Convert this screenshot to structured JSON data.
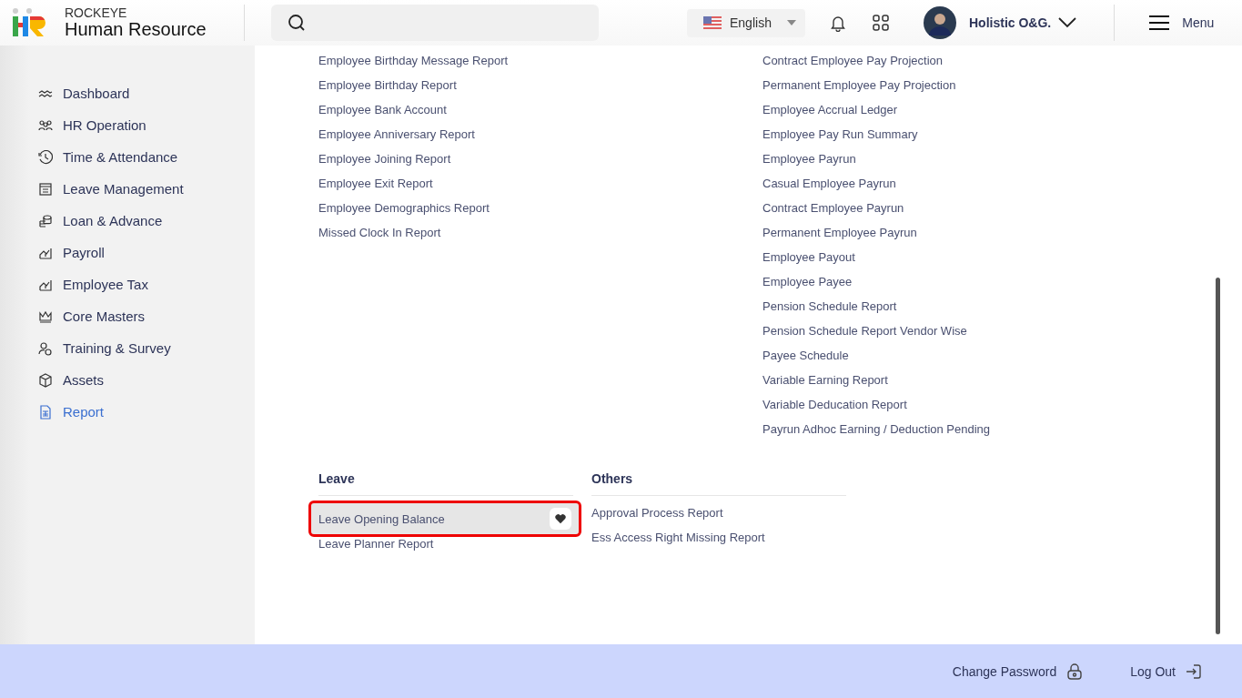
{
  "header": {
    "brand_top": "ROCKEYE",
    "brand": "Human Resource",
    "language": "English",
    "user": "Holistic O&G.",
    "menu": "Menu"
  },
  "sidebar": {
    "items": [
      {
        "label": "Dashboard",
        "selected": false
      },
      {
        "label": "HR Operation",
        "selected": false
      },
      {
        "label": "Time & Attendance",
        "selected": false
      },
      {
        "label": "Leave Management",
        "selected": false
      },
      {
        "label": "Loan & Advance",
        "selected": false
      },
      {
        "label": "Payroll",
        "selected": false
      },
      {
        "label": "Employee Tax",
        "selected": false
      },
      {
        "label": "Core Masters",
        "selected": false
      },
      {
        "label": "Training & Survey",
        "selected": false
      },
      {
        "label": "Assets",
        "selected": false
      },
      {
        "label": "Report",
        "selected": true
      }
    ]
  },
  "report_columns": [
    {
      "items": [
        "Employee Birthday Message Report",
        "Employee Birthday Report",
        "Employee Bank Account",
        "Employee Anniversary Report",
        "Employee Joining Report",
        "Employee Exit Report",
        "Employee Demographics Report",
        "Missed Clock In Report"
      ]
    },
    {
      "items": [
        "Contract Employee Pay Projection",
        "Permanent Employee Pay Projection",
        "Employee Accrual Ledger",
        "Employee Pay Run Summary",
        "Employee Payrun",
        "Casual Employee Payrun",
        "Contract Employee Payrun",
        "Permanent Employee Payrun",
        "Employee Payout",
        "Employee Payee",
        "Pension Schedule Report",
        "Pension Schedule Report Vendor Wise",
        "Payee Schedule",
        "Variable Earning Report",
        "Variable Deducation Report",
        "Payrun Adhoc Earning / Deduction Pending"
      ]
    }
  ],
  "sections": [
    {
      "title": "Leave",
      "items": [
        {
          "label": "Leave Opening Balance",
          "selected": true
        },
        {
          "label": "Leave Planner Report",
          "selected": false
        }
      ]
    },
    {
      "title": "Others",
      "items": [
        {
          "label": "Approval Process Report",
          "selected": false
        },
        {
          "label": "Ess Access Right Missing Report",
          "selected": false
        }
      ]
    }
  ],
  "footer": {
    "change_password": "Change Password",
    "log_out": "Log Out"
  }
}
